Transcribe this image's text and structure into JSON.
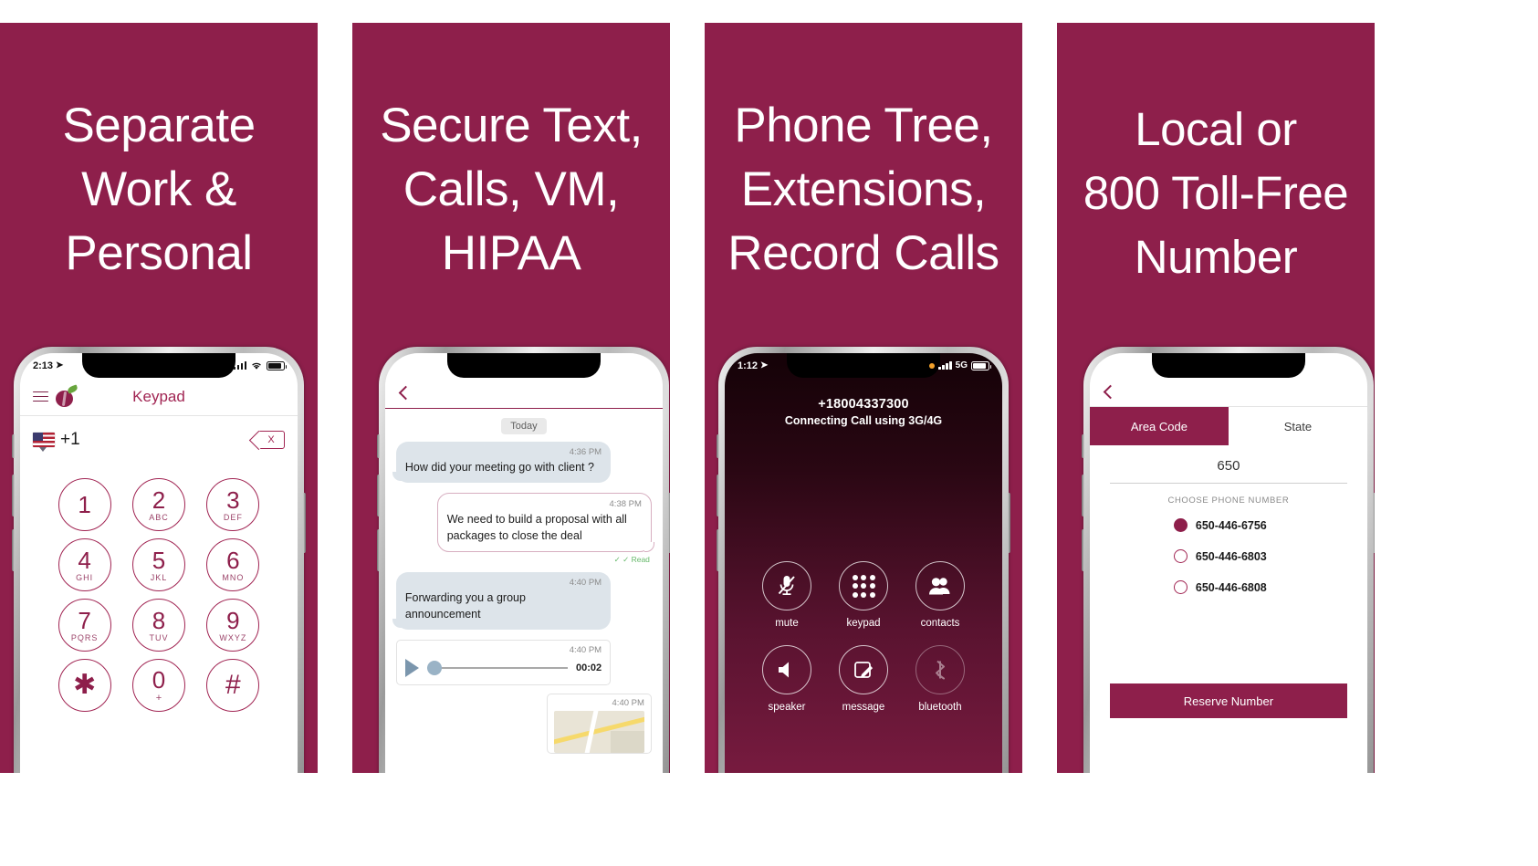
{
  "brand": {
    "maroon": "#8e1f4b",
    "white": "#ffffff"
  },
  "panels": [
    {
      "headline": "Separate\nWork &\nPersonal",
      "statusbar": {
        "time": "2:13",
        "location_icon": "location-arrow-icon",
        "signal_icon": "signal-bars-icon",
        "wifi_icon": "wifi-icon",
        "battery_icon": "battery-icon"
      },
      "nav": {
        "menu_icon": "hamburger-menu-icon",
        "logo_icon": "plum-logo-icon",
        "title": "Keypad"
      },
      "country": {
        "flag_icon": "us-flag-icon",
        "code": "+1",
        "caret_icon": "caret-down-icon",
        "delete_icon": "backspace-delete-icon",
        "delete_label": "X"
      },
      "keys": [
        {
          "digit": "1",
          "letters": ""
        },
        {
          "digit": "2",
          "letters": "ABC"
        },
        {
          "digit": "3",
          "letters": "DEF"
        },
        {
          "digit": "4",
          "letters": "GHI"
        },
        {
          "digit": "5",
          "letters": "JKL"
        },
        {
          "digit": "6",
          "letters": "MNO"
        },
        {
          "digit": "7",
          "letters": "PQRS"
        },
        {
          "digit": "8",
          "letters": "TUV"
        },
        {
          "digit": "9",
          "letters": "WXYZ"
        },
        {
          "digit": "✱",
          "letters": ""
        },
        {
          "digit": "0",
          "letters": "+"
        },
        {
          "digit": "#",
          "letters": ""
        }
      ]
    },
    {
      "headline": "Secure Text,\nCalls, VM,\nHIPAA",
      "nav": {
        "back_icon": "chevron-back-icon"
      },
      "day_label": "Today",
      "messages": [
        {
          "dir": "in",
          "time": "4:36 PM",
          "text": "How did your meeting go with client ?"
        },
        {
          "dir": "out",
          "time": "4:38 PM",
          "text": "We need to build a proposal with all packages to close the deal",
          "receipt": "✓ ✓ Read"
        },
        {
          "dir": "in",
          "time": "4:40 PM",
          "text": "Forwarding you a group announcement"
        }
      ],
      "voice": {
        "time": "4:40 PM",
        "duration": "00:02",
        "play_icon": "play-icon"
      },
      "map": {
        "time": "4:40 PM",
        "icon": "map-thumbnail"
      }
    },
    {
      "headline": "Phone Tree,\nExtensions,\nRecord Calls",
      "statusbar": {
        "time": "1:12",
        "location_icon": "location-arrow-icon",
        "signal_icon": "signal-bars-icon",
        "network": "5G",
        "battery_icon": "battery-icon"
      },
      "call": {
        "number": "+18004337300",
        "status": "Connecting Call using 3G/4G"
      },
      "buttons": [
        {
          "label": "mute",
          "icon": "microphone-muted-icon",
          "dim": false
        },
        {
          "label": "keypad",
          "icon": "keypad-dots-icon",
          "dim": false
        },
        {
          "label": "contacts",
          "icon": "contacts-people-icon",
          "dim": false
        },
        {
          "label": "speaker",
          "icon": "speaker-icon",
          "dim": false
        },
        {
          "label": "message",
          "icon": "compose-message-icon",
          "dim": false
        },
        {
          "label": "bluetooth",
          "icon": "bluetooth-icon",
          "dim": true
        }
      ]
    },
    {
      "headline": "Local or\n800 Toll-Free\nNumber",
      "nav": {
        "back_icon": "chevron-back-icon"
      },
      "tabs": [
        {
          "label": "Area Code",
          "active": true
        },
        {
          "label": "State",
          "active": false
        }
      ],
      "area_code": "650",
      "choose_label": "CHOOSE PHONE NUMBER",
      "numbers": [
        {
          "value": "650-446-6756",
          "selected": true
        },
        {
          "value": "650-446-6803",
          "selected": false
        },
        {
          "value": "650-446-6808",
          "selected": false
        }
      ],
      "reserve_label": "Reserve Number"
    }
  ]
}
